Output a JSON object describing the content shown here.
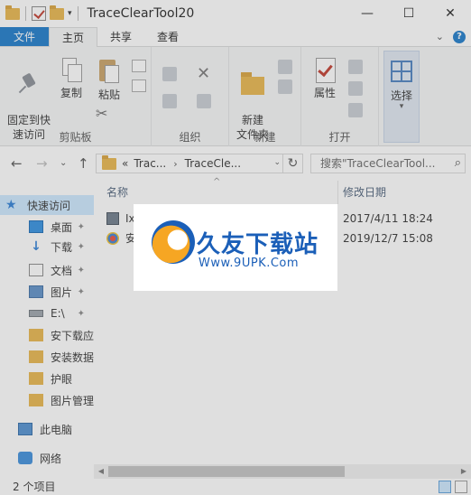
{
  "window": {
    "title": "TraceClearTool20",
    "controls": {
      "minimize": "—",
      "maximize": "☐",
      "close": "✕"
    }
  },
  "ribbon_tabs": {
    "file": "文件",
    "home": "主页",
    "share": "共享",
    "view": "查看",
    "expand": "⌄",
    "help": "?"
  },
  "ribbon": {
    "clipboard": {
      "pin_label": "固定到快\n速访问",
      "copy_label": "复制",
      "paste_label": "粘贴",
      "group_label": "剪贴板"
    },
    "organize": {
      "group_label": "组织"
    },
    "new": {
      "new_folder_label": "新建\n文件夹",
      "group_label": "新建"
    },
    "open": {
      "properties_label": "属性",
      "group_label": "打开"
    },
    "select": {
      "select_label": "选择"
    }
  },
  "address": {
    "back": "←",
    "forward": "→",
    "dropdown": "⌄",
    "up": "↑",
    "crumb_prefix": "«",
    "crumb1": "Trac...",
    "crumb_sep": "›",
    "crumb2": "TraceCle...",
    "crumb_dropdown": "⌄",
    "refresh": "↻",
    "search_placeholder": "搜索\"TraceClearTool...",
    "search_icon": "⌕"
  },
  "nav": {
    "quick_access": "快速访问",
    "items": [
      {
        "label": "桌面",
        "icon": "desktop-icon",
        "pinned": true
      },
      {
        "label": "下载",
        "icon": "download-icon",
        "pinned": true
      },
      {
        "label": "文档",
        "icon": "document-icon",
        "pinned": true
      },
      {
        "label": "图片",
        "icon": "picture-icon",
        "pinned": true
      },
      {
        "label": "E:\\",
        "icon": "drive-icon",
        "pinned": true
      },
      {
        "label": "安下载应",
        "icon": "folder-icon",
        "pinned": false
      },
      {
        "label": "安装数据",
        "icon": "folder-icon",
        "pinned": false
      },
      {
        "label": "护眼",
        "icon": "folder-icon",
        "pinned": false
      },
      {
        "label": "图片管理",
        "icon": "folder-icon",
        "pinned": false
      }
    ],
    "pin_glyph": "📌",
    "this_pc": "此电脑",
    "network": "网络"
  },
  "files": {
    "columns": {
      "name": "名称",
      "modified": "修改日期",
      "sort_arrow": "^"
    },
    "rows": [
      {
        "name": "TraceClearTool-v2.0.exe",
        "name_visible": "Ix",
        "date": "2017/4/11 18:24",
        "icon": "exe-icon"
      },
      {
        "name": "安下载应用",
        "name_visible": "安",
        "date": "2019/12/7 15:08",
        "icon": "shortcut-icon"
      }
    ]
  },
  "scrollbar": {
    "left": "◀",
    "right": "▶"
  },
  "status": {
    "item_count": "2 个项目"
  },
  "watermark": {
    "title": "久友下载站",
    "url": "Www.9UPK.Com"
  },
  "colors": {
    "file_tab": "#1979ca",
    "selection": "#cce8ff",
    "folder": "#e8b54a",
    "watermark_blue": "#1b5fb8",
    "watermark_orange": "#f6a623"
  }
}
